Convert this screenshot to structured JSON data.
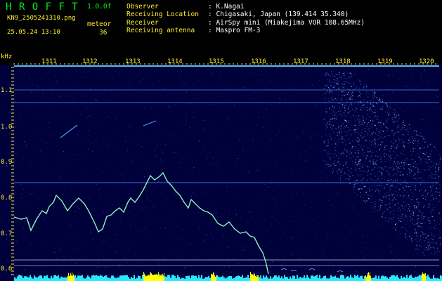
{
  "header": {
    "app_name": "H R O F F T",
    "version": "1.0.0f",
    "filename": "KN9_2505241310.png",
    "datetime": "25.05.24 13:10",
    "meteor_label": "meteor",
    "meteor_count": "36",
    "info": [
      {
        "label": "Observer",
        "value": ": K.Nagai"
      },
      {
        "label": "Receiving Location",
        "value": ": Chigasaki, Japan (139.414 35.340)"
      },
      {
        "label": "Receiver",
        "value": ": AirSpy mini (Miakejima VOR 108.65MHz)"
      },
      {
        "label": "Receiving antenna",
        "value": ": Maspro FM-3"
      }
    ]
  },
  "axes": {
    "unit": "kHz",
    "y_ticks": [
      "1.1",
      "1.0",
      "0.9",
      "0.8",
      "0.7",
      "0.6"
    ],
    "x_ticks": [
      "1311",
      "1312",
      "1313",
      "1314",
      "1315",
      "1316",
      "1317",
      "1318",
      "1319",
      "1320"
    ]
  },
  "colors": {
    "background": "#00003a",
    "axis_text": "#ffee33",
    "header_green": "#00ee22",
    "signal": "#8ff0c0",
    "noise_cyan": "#28e8ff",
    "noise_yellow": "#ffff00"
  }
}
